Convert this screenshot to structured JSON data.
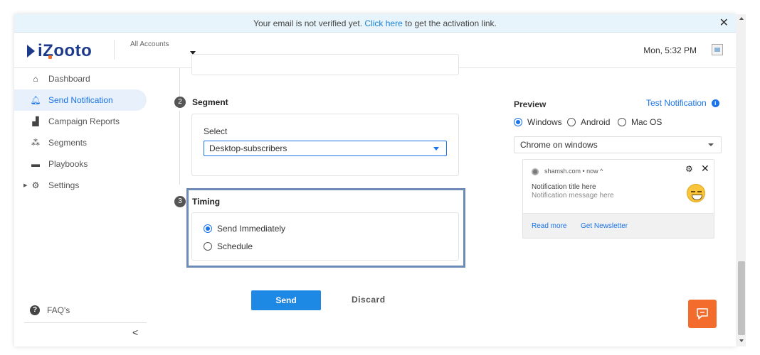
{
  "banner": {
    "prefix": "Your email is not verified yet.",
    "link": "Click here",
    "suffix": "to get the activation link.",
    "close": "✕"
  },
  "header": {
    "logo": "iZooto",
    "accounts_label": "All Accounts",
    "clock": "Mon, 5:32 PM"
  },
  "sidebar": {
    "items": [
      {
        "label": "Dashboard",
        "icon": "home-icon",
        "glyph": "🏠"
      },
      {
        "label": "Send Notification",
        "icon": "bell-icon",
        "glyph": "🔔"
      },
      {
        "label": "Campaign Reports",
        "icon": "bar-chart-icon",
        "glyph": "▟"
      },
      {
        "label": "Segments",
        "icon": "people-icon",
        "glyph": "👥"
      },
      {
        "label": "Playbooks",
        "icon": "gamepad-icon",
        "glyph": "🎮"
      },
      {
        "label": "Settings",
        "icon": "gear-icon",
        "glyph": "⚙"
      }
    ],
    "faq": "FAQ's",
    "collapse": "<"
  },
  "segment": {
    "step": "2",
    "title": "Segment",
    "select_label": "Select",
    "selected": "Desktop-subscribers"
  },
  "timing": {
    "step": "3",
    "title": "Timing",
    "options": [
      "Send Immediately",
      "Schedule"
    ],
    "selected": "Send Immediately"
  },
  "actions": {
    "send": "Send",
    "discard": "Discard"
  },
  "preview": {
    "title": "Preview",
    "test_link": "Test Notification",
    "os_options": [
      "Windows",
      "Android",
      "Mac OS"
    ],
    "os_selected": "Windows",
    "browser": "Chrome on windows",
    "notification": {
      "site": "shamsh.com • now ^",
      "title": "Notification title here",
      "message": "Notification message here",
      "buttons": [
        "Read more",
        "Get Newsletter"
      ]
    }
  },
  "colors": {
    "accent": "#1a73e8",
    "send_button": "#1e88e5",
    "chat_button": "#f36c2b",
    "highlight_border": "#6e8bb8"
  }
}
